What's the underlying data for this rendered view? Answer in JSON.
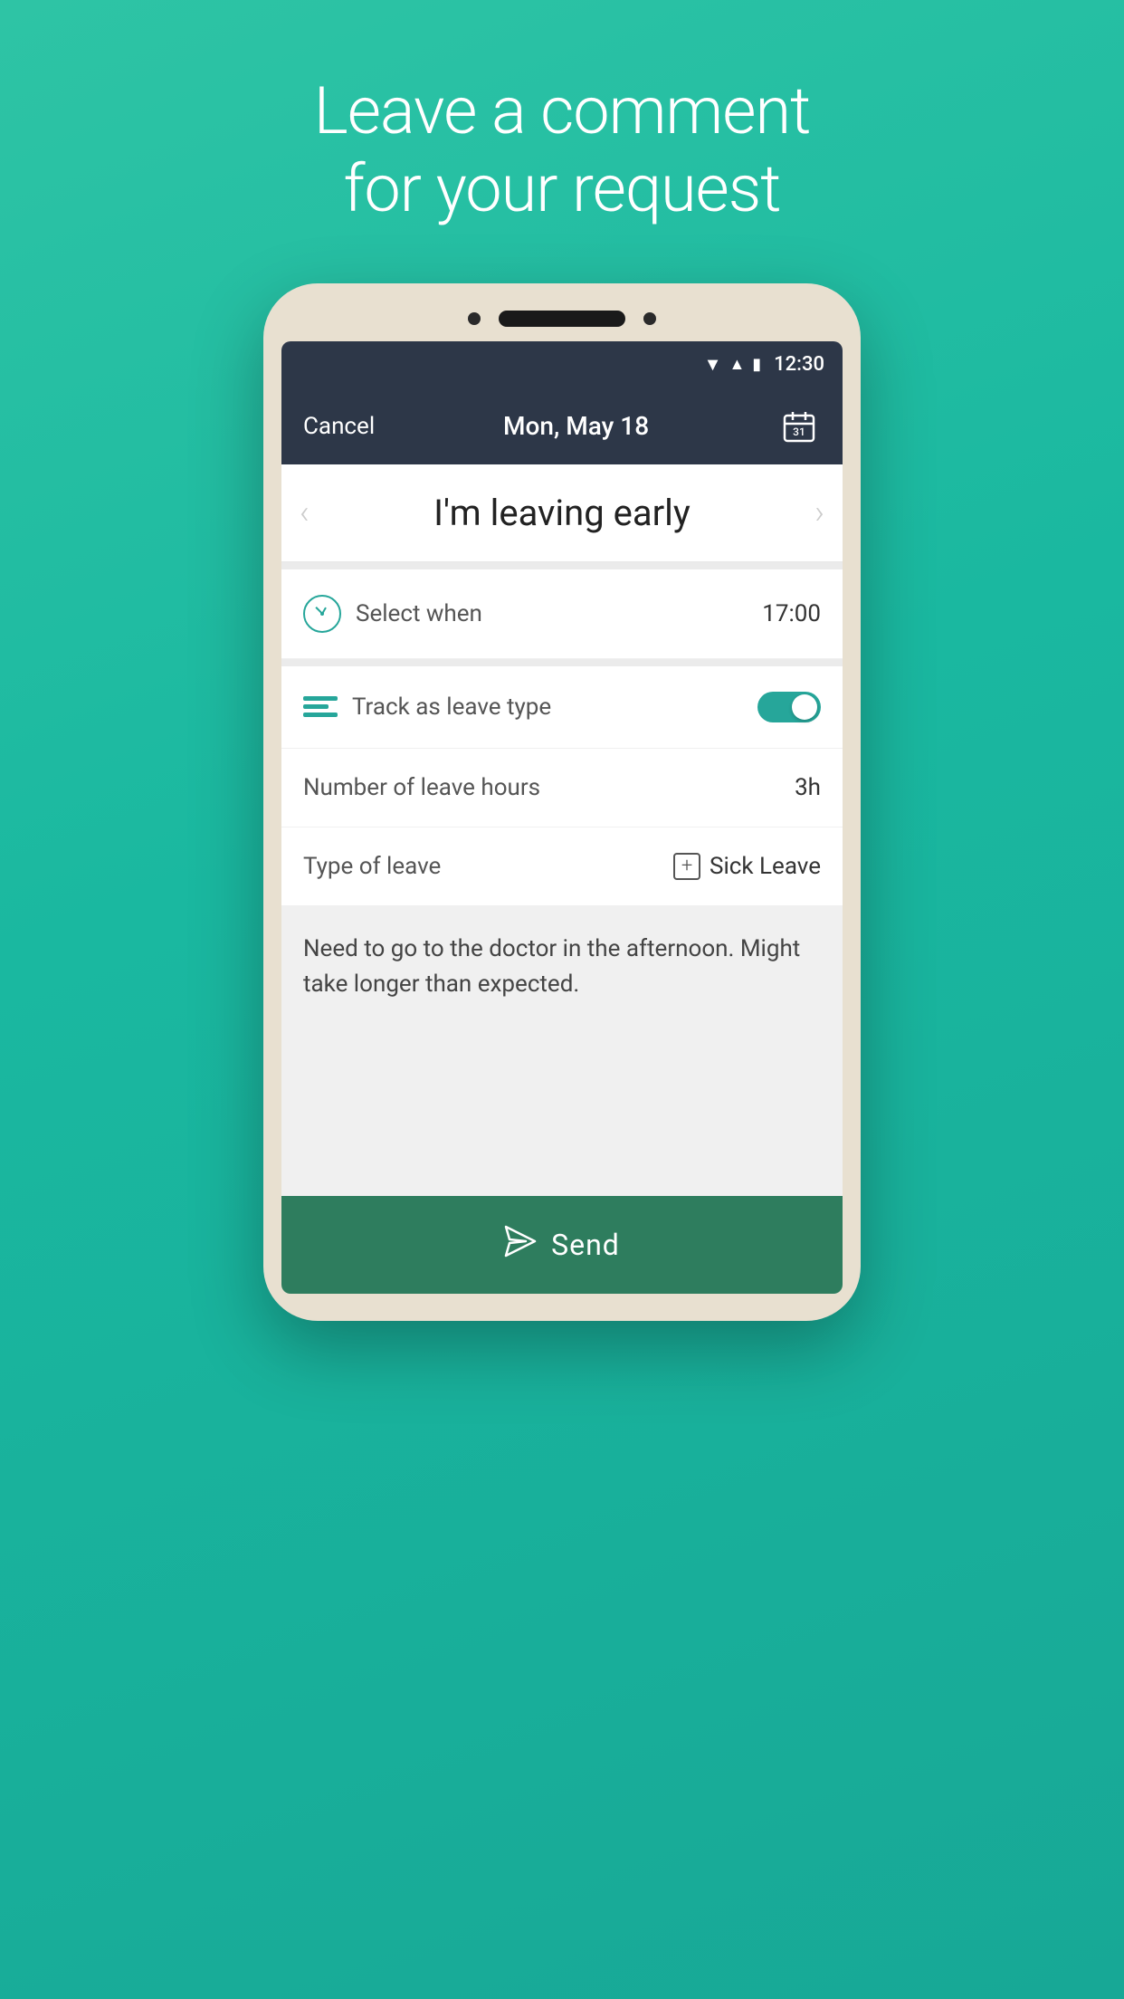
{
  "page": {
    "title_line1": "Leave a comment",
    "title_line2": "for your request",
    "background_color_top": "#2ec4a5",
    "background_color_bottom": "#17a896"
  },
  "status_bar": {
    "time": "12:30"
  },
  "app_header": {
    "cancel_label": "Cancel",
    "date": "Mon, May 18"
  },
  "request_nav": {
    "title": "I'm leaving early"
  },
  "form": {
    "select_when_label": "Select when",
    "select_when_value": "17:00",
    "track_leave_label": "Track as leave type",
    "leave_hours_label": "Number of leave hours",
    "leave_hours_value": "3h",
    "type_of_leave_label": "Type of leave",
    "type_of_leave_value": "Sick Leave"
  },
  "comment": {
    "text": "Need to go to the doctor in the afternoon.\nMight take longer than expected."
  },
  "send_button": {
    "label": "Send"
  }
}
